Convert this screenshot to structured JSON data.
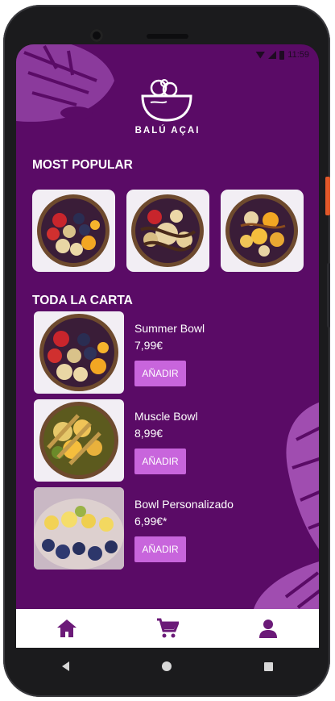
{
  "brand": {
    "name": "BALÚ AÇAI",
    "logo_icon": "acai-bowl-logo-icon"
  },
  "status_bar": {
    "time": "11:59"
  },
  "colors": {
    "background": "#5a0b66",
    "button": "#c865dc",
    "leaf": "#8b3a9c",
    "nav_icon": "#6b1a78"
  },
  "most_popular": {
    "title": "MOST POPULAR",
    "items": [
      {
        "image": "strawberry-banana-blueberry-bowl"
      },
      {
        "image": "chocolate-drizzle-bowl"
      },
      {
        "image": "mango-caramel-bowl"
      }
    ]
  },
  "menu": {
    "title": "TODA LA CARTA",
    "items": [
      {
        "name": "Summer Bowl",
        "price": "7,99€",
        "button": "AÑADIR",
        "image": "summer-bowl"
      },
      {
        "name": "Muscle Bowl",
        "price": "8,99€",
        "button": "AÑADIR",
        "image": "muscle-bowl"
      },
      {
        "name": "Bowl Personalizado",
        "price": "6,99€*",
        "button": "AÑADIR",
        "image": "custom-bowl"
      }
    ]
  },
  "bottom_nav": {
    "items": [
      {
        "icon": "home-icon"
      },
      {
        "icon": "cart-icon"
      },
      {
        "icon": "profile-icon"
      }
    ]
  }
}
